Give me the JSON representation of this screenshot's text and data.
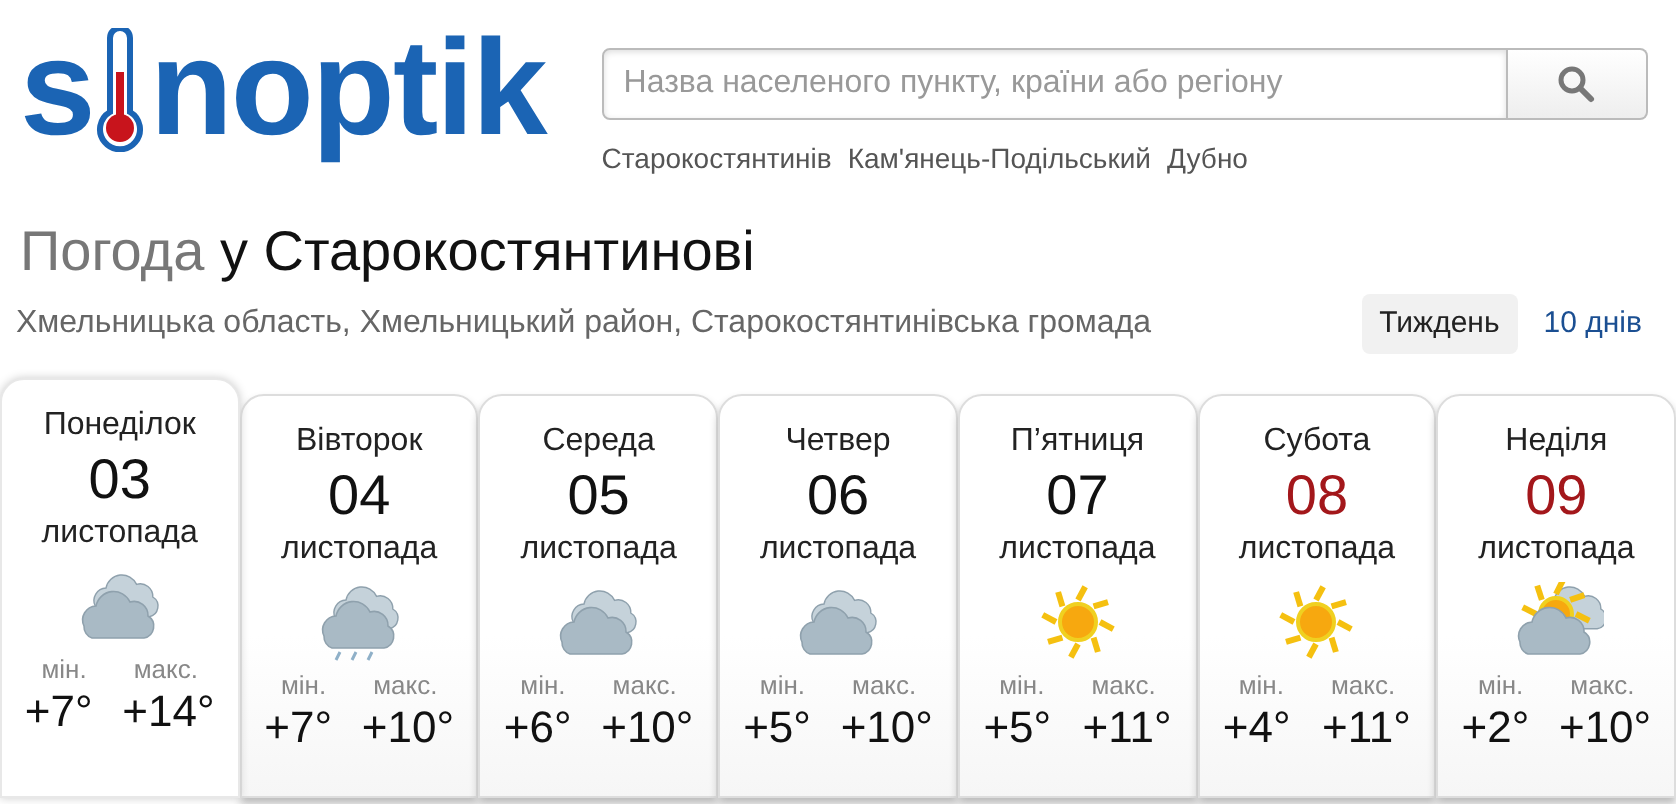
{
  "logo": {
    "before": "s",
    "after": "noptik"
  },
  "search": {
    "placeholder": "Назва населеного пункту, країни або регіону"
  },
  "recent_cities": [
    "Старокостянтинів",
    "Кам'янець-Подільський",
    "Дубно"
  ],
  "title": {
    "prefix": "Погода",
    "place": "у Старокостянтинові"
  },
  "region": "Хмельницька область, Хмельницький район, Старокостянтинівська громада",
  "range_tabs": [
    {
      "label": "Тиждень",
      "selected": true
    },
    {
      "label": "10 днів",
      "selected": false
    }
  ],
  "days": [
    {
      "weekday": "Понеділок",
      "date": "03",
      "month": "листопада",
      "weekend": false,
      "selected": true,
      "kind": "clouds",
      "min_label": "мін.",
      "min": "+7°",
      "max_label": "макс.",
      "max": "+14°"
    },
    {
      "weekday": "Вівторок",
      "date": "04",
      "month": "листопада",
      "weekend": false,
      "selected": false,
      "kind": "rain",
      "min_label": "мін.",
      "min": "+7°",
      "max_label": "макс.",
      "max": "+10°"
    },
    {
      "weekday": "Середа",
      "date": "05",
      "month": "листопада",
      "weekend": false,
      "selected": false,
      "kind": "clouds",
      "min_label": "мін.",
      "min": "+6°",
      "max_label": "макс.",
      "max": "+10°"
    },
    {
      "weekday": "Четвер",
      "date": "06",
      "month": "листопада",
      "weekend": false,
      "selected": false,
      "kind": "clouds",
      "min_label": "мін.",
      "min": "+5°",
      "max_label": "макс.",
      "max": "+10°"
    },
    {
      "weekday": "П’ятниця",
      "date": "07",
      "month": "листопада",
      "weekend": false,
      "selected": false,
      "kind": "sun",
      "min_label": "мін.",
      "min": "+5°",
      "max_label": "макс.",
      "max": "+11°"
    },
    {
      "weekday": "Субота",
      "date": "08",
      "month": "листопада",
      "weekend": true,
      "selected": false,
      "kind": "sun",
      "min_label": "мін.",
      "min": "+4°",
      "max_label": "макс.",
      "max": "+11°"
    },
    {
      "weekday": "Неділя",
      "date": "09",
      "month": "листопада",
      "weekend": true,
      "selected": false,
      "kind": "sun-clouds",
      "min_label": "мін.",
      "min": "+2°",
      "max_label": "макс.",
      "max": "+10°"
    }
  ]
}
